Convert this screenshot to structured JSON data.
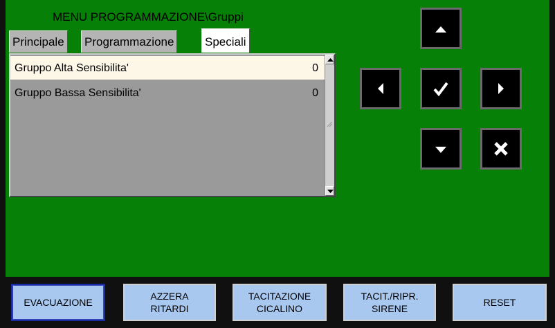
{
  "title": "MENU PROGRAMMAZIONE\\Gruppi",
  "tabs": [
    {
      "label": "Principale",
      "active": false
    },
    {
      "label": "Programmazione",
      "active": false
    },
    {
      "label": "Speciali",
      "active": true
    }
  ],
  "list": {
    "rows": [
      {
        "label": "Gruppo Alta Sensibilita'",
        "value": "0",
        "selected": true
      },
      {
        "label": "Gruppo Bassa Sensibilita'",
        "value": "0",
        "selected": false
      }
    ]
  },
  "nav_buttons": {
    "up": "arrow-up-icon",
    "left": "arrow-left-icon",
    "confirm": "checkmark-icon",
    "right": "arrow-right-icon",
    "down": "arrow-down-icon",
    "cancel": "cross-icon"
  },
  "function_buttons": [
    {
      "line1": "EVACUAZIONE",
      "line2": ""
    },
    {
      "line1": "AZZERA",
      "line2": "RITARDI"
    },
    {
      "line1": "TACITAZIONE",
      "line2": "CICALINO"
    },
    {
      "line1": "TACIT./RIPR.",
      "line2": "SIRENE"
    },
    {
      "line1": "RESET",
      "line2": ""
    }
  ],
  "colors": {
    "panel": "#078007",
    "selected_row": "#fdf7e8",
    "function_button": "#a8c8f0",
    "nav_button": "#000000"
  }
}
